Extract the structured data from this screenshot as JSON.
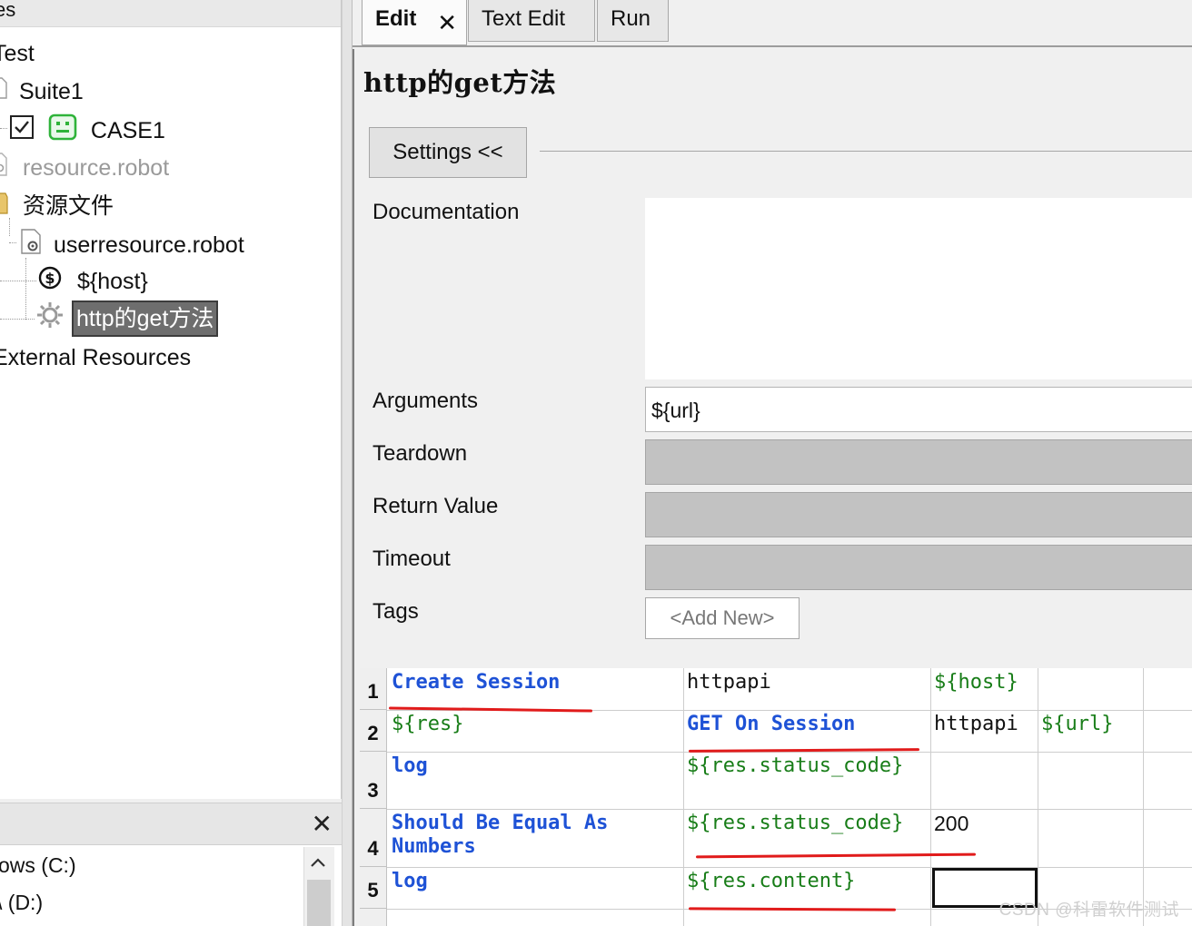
{
  "tree": {
    "header_fragment": "es",
    "nodes": [
      {
        "label": "Test"
      },
      {
        "label": "Suite1"
      },
      {
        "label": "CASE1"
      },
      {
        "label": "resource.robot"
      },
      {
        "label": "资源文件"
      },
      {
        "label": "userresource.robot"
      },
      {
        "label": "${host}"
      },
      {
        "label": "http的get方法"
      },
      {
        "label": "External Resources"
      }
    ]
  },
  "file_pane": {
    "close_symbol": "✕",
    "items": [
      "ows (C:)",
      "\\ (D:)"
    ]
  },
  "tabs": [
    {
      "label": "Edit",
      "active": true
    },
    {
      "label": "Text Edit",
      "active": false
    },
    {
      "label": "Run",
      "active": false
    }
  ],
  "editor": {
    "keyword_name": "http的get方法",
    "settings_button": "Settings <<",
    "fields": {
      "documentation": "Documentation",
      "arguments": "Arguments",
      "teardown": "Teardown",
      "return_value": "Return Value",
      "timeout": "Timeout",
      "tags": "Tags"
    },
    "arguments_value": "${url}",
    "tags_add_new": "<Add New>"
  },
  "grid": {
    "row_numbers": [
      "1",
      "2",
      "3",
      "4",
      "5"
    ],
    "rows": [
      [
        "Create Session",
        "httpapi",
        "${host}",
        ""
      ],
      [
        "${res}",
        "GET On Session",
        "httpapi",
        "${url}"
      ],
      [
        "log",
        "${res.status_code}",
        "",
        ""
      ],
      [
        "Should Be Equal As",
        "${res.status_code}",
        "200",
        ""
      ],
      [
        "log",
        "${res.content}",
        "",
        ""
      ]
    ],
    "row4_cell1_line2": "Numbers",
    "colors": {
      "keyword": "#1e52d6",
      "variable": "#187d18",
      "annotation": "#e11b1b"
    }
  },
  "watermark": "CSDN @科雷软件测试"
}
